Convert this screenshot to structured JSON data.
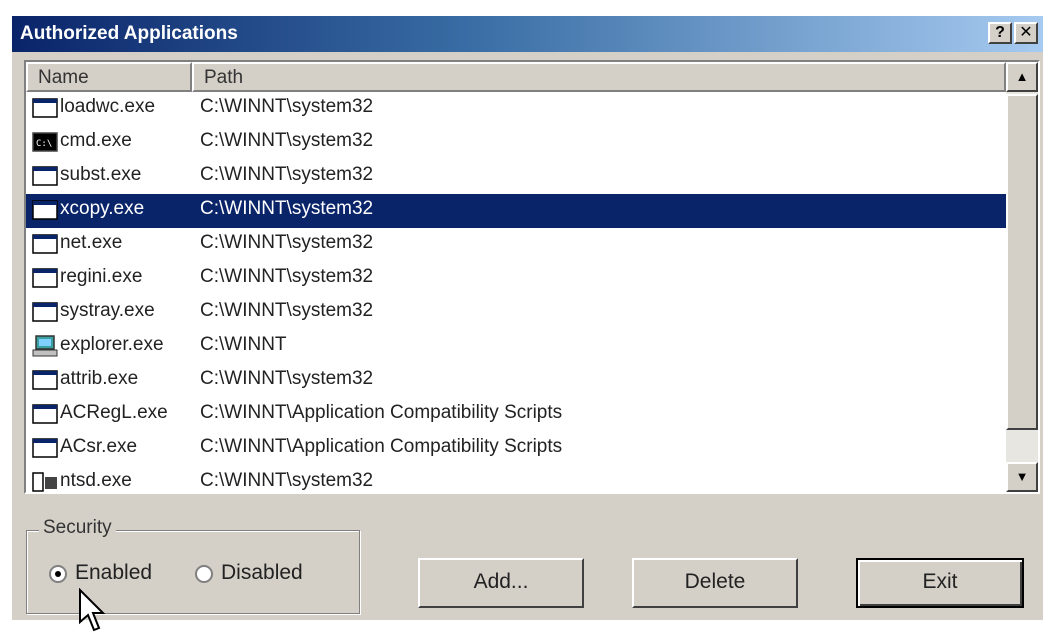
{
  "window": {
    "title": "Authorized Applications",
    "help_label": "?",
    "close_label": "✕"
  },
  "listview": {
    "columns": {
      "name": "Name",
      "path": "Path"
    },
    "rows": [
      {
        "name": "loadwc.exe",
        "path": "C:\\WINNT\\system32",
        "icon": "window-app-icon",
        "selected": false
      },
      {
        "name": "cmd.exe",
        "path": "C:\\WINNT\\system32",
        "icon": "console-app-icon",
        "selected": false
      },
      {
        "name": "subst.exe",
        "path": "C:\\WINNT\\system32",
        "icon": "window-app-icon",
        "selected": false
      },
      {
        "name": "xcopy.exe",
        "path": "C:\\WINNT\\system32",
        "icon": "window-app-icon",
        "selected": true
      },
      {
        "name": "net.exe",
        "path": "C:\\WINNT\\system32",
        "icon": "window-app-icon",
        "selected": false
      },
      {
        "name": "regini.exe",
        "path": "C:\\WINNT\\system32",
        "icon": "window-app-icon",
        "selected": false
      },
      {
        "name": "systray.exe",
        "path": "C:\\WINNT\\system32",
        "icon": "window-app-icon",
        "selected": false
      },
      {
        "name": "explorer.exe",
        "path": "C:\\WINNT",
        "icon": "explorer-computer-icon",
        "selected": false
      },
      {
        "name": "attrib.exe",
        "path": "C:\\WINNT\\system32",
        "icon": "window-app-icon",
        "selected": false
      },
      {
        "name": "ACRegL.exe",
        "path": "C:\\WINNT\\Application Compatibility Scripts",
        "icon": "window-app-icon",
        "selected": false
      },
      {
        "name": "ACsr.exe",
        "path": "C:\\WINNT\\Application Compatibility Scripts",
        "icon": "window-app-icon",
        "selected": false
      },
      {
        "name": "ntsd.exe",
        "path": "C:\\WINNT\\system32",
        "icon": "debugger-app-icon",
        "selected": false
      }
    ]
  },
  "security": {
    "legend": "Security",
    "enabled_label": "Enabled",
    "disabled_label": "Disabled",
    "selected": "Enabled"
  },
  "buttons": {
    "add": "Add...",
    "delete": "Delete",
    "exit": "Exit"
  },
  "colors": {
    "title_start": "#0a246a",
    "title_end": "#a6caf0",
    "selection": "#0a246a",
    "face": "#d4d0c8"
  }
}
